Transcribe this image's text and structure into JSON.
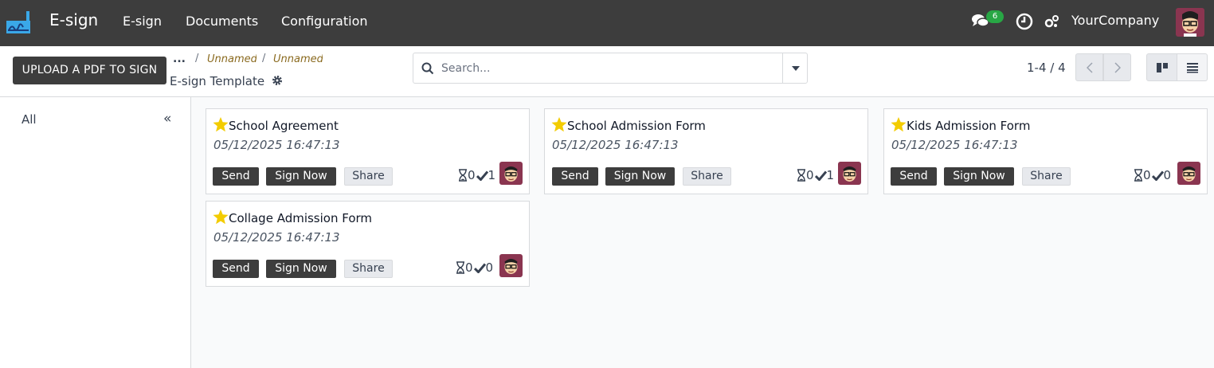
{
  "navbar": {
    "app_name": "E-sign",
    "menus": [
      "E-sign",
      "Documents",
      "Configuration"
    ],
    "messages_badge": "6",
    "company": "YourCompany"
  },
  "control_panel": {
    "upload_label": "UPLOAD A PDF TO SIGN",
    "breadcrumb_dots": "...",
    "breadcrumb_sep": "/",
    "breadcrumb_links": [
      "Unnamed",
      "Unnamed"
    ],
    "breadcrumb_current": "E-sign Template",
    "search_placeholder": "Search...",
    "pager": "1-4 / 4"
  },
  "sidebar": {
    "all_label": "All",
    "fold_label": "«"
  },
  "cards": [
    {
      "title": "School Agreement",
      "date": "05/12/2025 16:47:13",
      "send": "Send",
      "sign_now": "Sign Now",
      "share": "Share",
      "waiting": "0",
      "signed": "1"
    },
    {
      "title": "School Admission Form",
      "date": "05/12/2025 16:47:13",
      "send": "Send",
      "sign_now": "Sign Now",
      "share": "Share",
      "waiting": "0",
      "signed": "1"
    },
    {
      "title": "Kids Admission Form",
      "date": "05/12/2025 16:47:13",
      "send": "Send",
      "sign_now": "Sign Now",
      "share": "Share",
      "waiting": "0",
      "signed": "0"
    },
    {
      "title": "Collage Admission Form",
      "date": "05/12/2025 16:47:13",
      "send": "Send",
      "sign_now": "Sign Now",
      "share": "Share",
      "waiting": "0",
      "signed": "0"
    }
  ],
  "colors": {
    "navbar": "#3d3d3d",
    "star": "#f3cc00",
    "badge": "#28a745",
    "breadcrumb_link": "#8a6a1f"
  }
}
